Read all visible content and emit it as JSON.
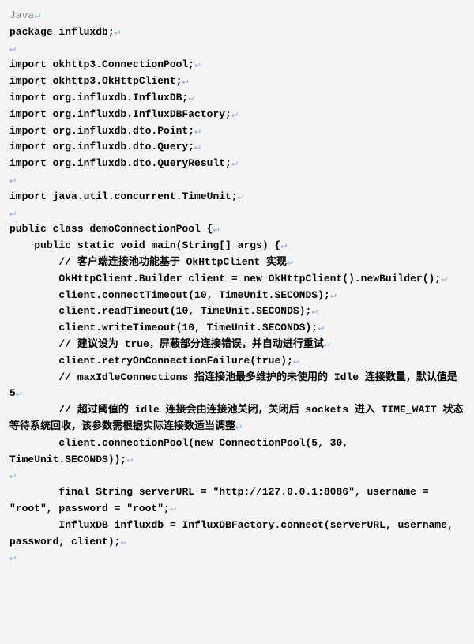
{
  "lang": "Java",
  "lines": [
    "package influxdb;",
    "",
    "import okhttp3.ConnectionPool;",
    "import okhttp3.OkHttpClient;",
    "import org.influxdb.InfluxDB;",
    "import org.influxdb.InfluxDBFactory;",
    "import org.influxdb.dto.Point;",
    "import org.influxdb.dto.Query;",
    "import org.influxdb.dto.QueryResult;",
    "",
    "import java.util.concurrent.TimeUnit;",
    "",
    "public class demoConnectionPool {",
    "    public static void main(String[] args) {",
    "        // 客户端连接池功能基于 OkHttpClient 实现",
    "        OkHttpClient.Builder client = new OkHttpClient().newBuilder();",
    "        client.connectTimeout(10, TimeUnit.SECONDS);",
    "        client.readTimeout(10, TimeUnit.SECONDS);",
    "        client.writeTimeout(10, TimeUnit.SECONDS);",
    "        // 建议设为 true，屏蔽部分连接错误，并自动进行重试",
    "        client.retryOnConnectionFailure(true);",
    "        // maxIdleConnections 指连接池最多维护的未使用的 Idle 连接数量，默认值是 5",
    "        // 超过阈值的 idle 连接会由连接池关闭，关闭后 sockets 进入 TIME_WAIT 状态等待系统回收，该参数需根据实际连接数适当调整",
    "        client.connectionPool(new ConnectionPool(5, 30, TimeUnit.SECONDS));",
    "",
    "        final String serverURL = \"http://127.0.0.1:8086\", username = \"root\", password = \"root\";",
    "        InfluxDB influxdb = InfluxDBFactory.connect(serverURL, username, password, client);",
    ""
  ],
  "newline_glyph": "↵"
}
